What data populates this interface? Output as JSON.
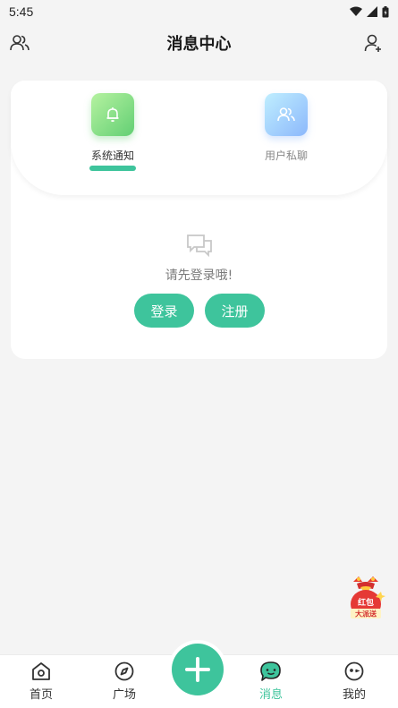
{
  "status_bar": {
    "time": "5:45"
  },
  "header": {
    "title": "消息中心"
  },
  "tabs": [
    {
      "label": "系统通知",
      "active": true
    },
    {
      "label": "用户私聊",
      "active": false
    }
  ],
  "empty_state": {
    "message": "请先登录哦!"
  },
  "buttons": {
    "login": "登录",
    "register": "注册"
  },
  "red_packet": {
    "line1": "红包",
    "line2": "大派送"
  },
  "bottom_nav": [
    {
      "label": "首页",
      "icon": "home-icon",
      "active": false
    },
    {
      "label": "广场",
      "icon": "compass-icon",
      "active": false
    },
    {
      "label": "消息",
      "icon": "message-icon",
      "active": true
    },
    {
      "label": "我的",
      "icon": "profile-icon",
      "active": false
    }
  ],
  "colors": {
    "accent": "#3ec49c",
    "background": "#f4f4f4"
  }
}
